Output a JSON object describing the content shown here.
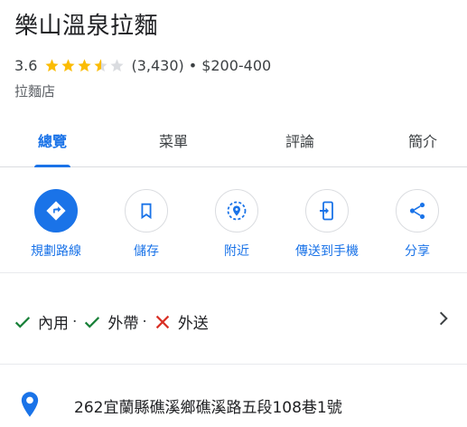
{
  "place": {
    "name": "樂山溫泉拉麵",
    "rating": "3.6",
    "stars_value": 3.6,
    "review_count": "(3,430)",
    "separator": "•",
    "price_range": "$200-400",
    "category": "拉麵店"
  },
  "tabs": [
    {
      "label": "總覽",
      "active": true
    },
    {
      "label": "菜單",
      "active": false
    },
    {
      "label": "評論",
      "active": false
    },
    {
      "label": "簡介",
      "active": false
    }
  ],
  "actions": [
    {
      "label": "規劃路線",
      "icon": "directions-icon"
    },
    {
      "label": "儲存",
      "icon": "bookmark-icon"
    },
    {
      "label": "附近",
      "icon": "nearby-icon"
    },
    {
      "label": "傳送到手機",
      "icon": "send-to-phone-icon"
    },
    {
      "label": "分享",
      "icon": "share-icon"
    }
  ],
  "services": [
    {
      "label": "內用",
      "available": true,
      "sep": "·"
    },
    {
      "label": "外帶",
      "available": true,
      "sep": "·"
    },
    {
      "label": "外送",
      "available": false,
      "sep": ""
    }
  ],
  "address": "262宜蘭縣礁溪鄉礁溪路五段108巷1號",
  "colors": {
    "accent": "#1a73e8",
    "star": "#fbbc04",
    "star_empty": "#dadce0",
    "check": "#188038",
    "cross": "#d93025"
  }
}
